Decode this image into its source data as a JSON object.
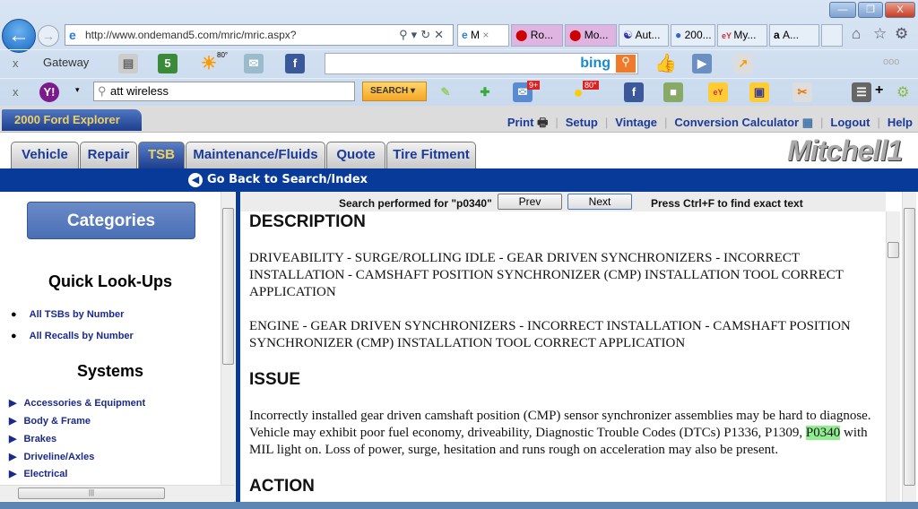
{
  "browser": {
    "url": "http://www.ondemand5.com/mric/mric.aspx?",
    "tabs": [
      {
        "label": "M",
        "active": true
      },
      {
        "label": "Ro..."
      },
      {
        "label": "Mo..."
      },
      {
        "label": "Aut..."
      },
      {
        "label": "200..."
      },
      {
        "label": "My..."
      },
      {
        "label": "A..."
      }
    ],
    "toolbar1": {
      "label": "Gateway",
      "weather": "80°",
      "search_brand": "bing"
    },
    "toolbar2": {
      "search_value": "att wireless",
      "search_button": "SEARCH",
      "mail_badge": "9+",
      "weather": "80°"
    }
  },
  "header": {
    "vehicle": "2000 Ford Explorer",
    "links": [
      "Print",
      "Setup",
      "Vintage",
      "Conversion Calculator",
      "Logout",
      "Help"
    ]
  },
  "tabs": [
    "Vehicle",
    "Repair",
    "TSB",
    "Maintenance/Fluids",
    "Quote",
    "Tire Fitment"
  ],
  "active_tab": "TSB",
  "logo": "Mitchell1",
  "back_link": "Go Back to Search/Index",
  "left": {
    "categories_button": "Categories",
    "quick_heading": "Quick Look-Ups",
    "quick_links": [
      "All TSBs by Number",
      "All Recalls by Number"
    ],
    "systems_heading": "Systems",
    "systems": [
      "Accessories & Equipment",
      "Body & Frame",
      "Brakes",
      "Driveline/Axles",
      "Electrical"
    ]
  },
  "search": {
    "text": "Search performed for \"p0340\"",
    "prev": "Prev",
    "next": "Next",
    "hint": "Press Ctrl+F to find exact text"
  },
  "document": {
    "h_description": "DESCRIPTION",
    "desc1": "DRIVEABILITY - SURGE/ROLLING IDLE - GEAR DRIVEN SYNCHRONIZERS - INCORRECT INSTALLATION - CAMSHAFT POSITION SYNCHRONIZER (CMP) INSTALLATION TOOL CORRECT APPLICATION",
    "desc2": "ENGINE - GEAR DRIVEN SYNCHRONIZERS - INCORRECT INSTALLATION - CAMSHAFT POSITION SYNCHRONIZER (CMP) INSTALLATION TOOL CORRECT APPLICATION",
    "h_issue": "ISSUE",
    "issue_a": "Incorrectly installed gear driven camshaft position (CMP) sensor synchronizer assemblies may be hard to diagnose. Vehicle may exhibit poor fuel economy, driveability, Diagnostic Trouble Codes (DTCs) P1336, P1309, ",
    "issue_hl": "P0340",
    "issue_b": " with MIL light on. Loss of power, surge, hesitation and runs rough on acceleration may also be present.",
    "h_action": "ACTION"
  }
}
